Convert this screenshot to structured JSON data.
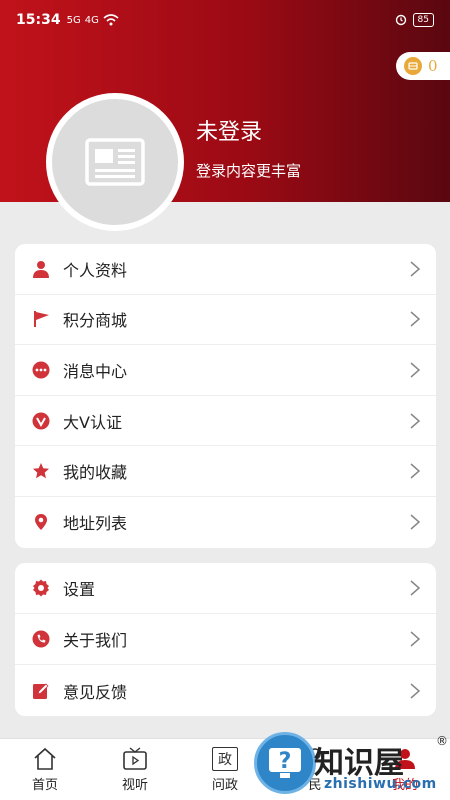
{
  "status_bar": {
    "time": "15:34",
    "signal1": "5G",
    "signal2": "4G",
    "battery": "85"
  },
  "coins": {
    "count": "0",
    "icon": "coin-icon",
    "color": "#e8a93a"
  },
  "profile": {
    "name": "未登录",
    "subtitle": "登录内容更丰富",
    "avatar_icon": "newspaper-icon"
  },
  "menu_group_1": [
    {
      "label": "个人资料",
      "icon": "person-icon"
    },
    {
      "label": "积分商城",
      "icon": "flag-icon"
    },
    {
      "label": "消息中心",
      "icon": "chat-bubble-icon"
    },
    {
      "label": "大V认证",
      "icon": "verified-v-icon"
    },
    {
      "label": "我的收藏",
      "icon": "star-icon"
    },
    {
      "label": "地址列表",
      "icon": "location-pin-icon"
    }
  ],
  "menu_group_2": [
    {
      "label": "设置",
      "icon": "gear-icon"
    },
    {
      "label": "关于我们",
      "icon": "phone-icon"
    },
    {
      "label": "意见反馈",
      "icon": "edit-icon"
    }
  ],
  "tabbar": [
    {
      "label": "首页",
      "icon": "home-icon"
    },
    {
      "label": "视听",
      "icon": "tv-icon"
    },
    {
      "label": "问政",
      "icon": "ask-icon",
      "glyph": "政"
    },
    {
      "label": "民",
      "icon": "people-icon"
    },
    {
      "label": "我的",
      "icon": "me-icon",
      "active": true
    }
  ],
  "watermark": {
    "text": "知识屋",
    "sub": "zhishiwu.com",
    "reg": "®",
    "glyph": "?"
  },
  "colors": {
    "accent": "#c1121b",
    "icon_red": "#d0343a"
  }
}
